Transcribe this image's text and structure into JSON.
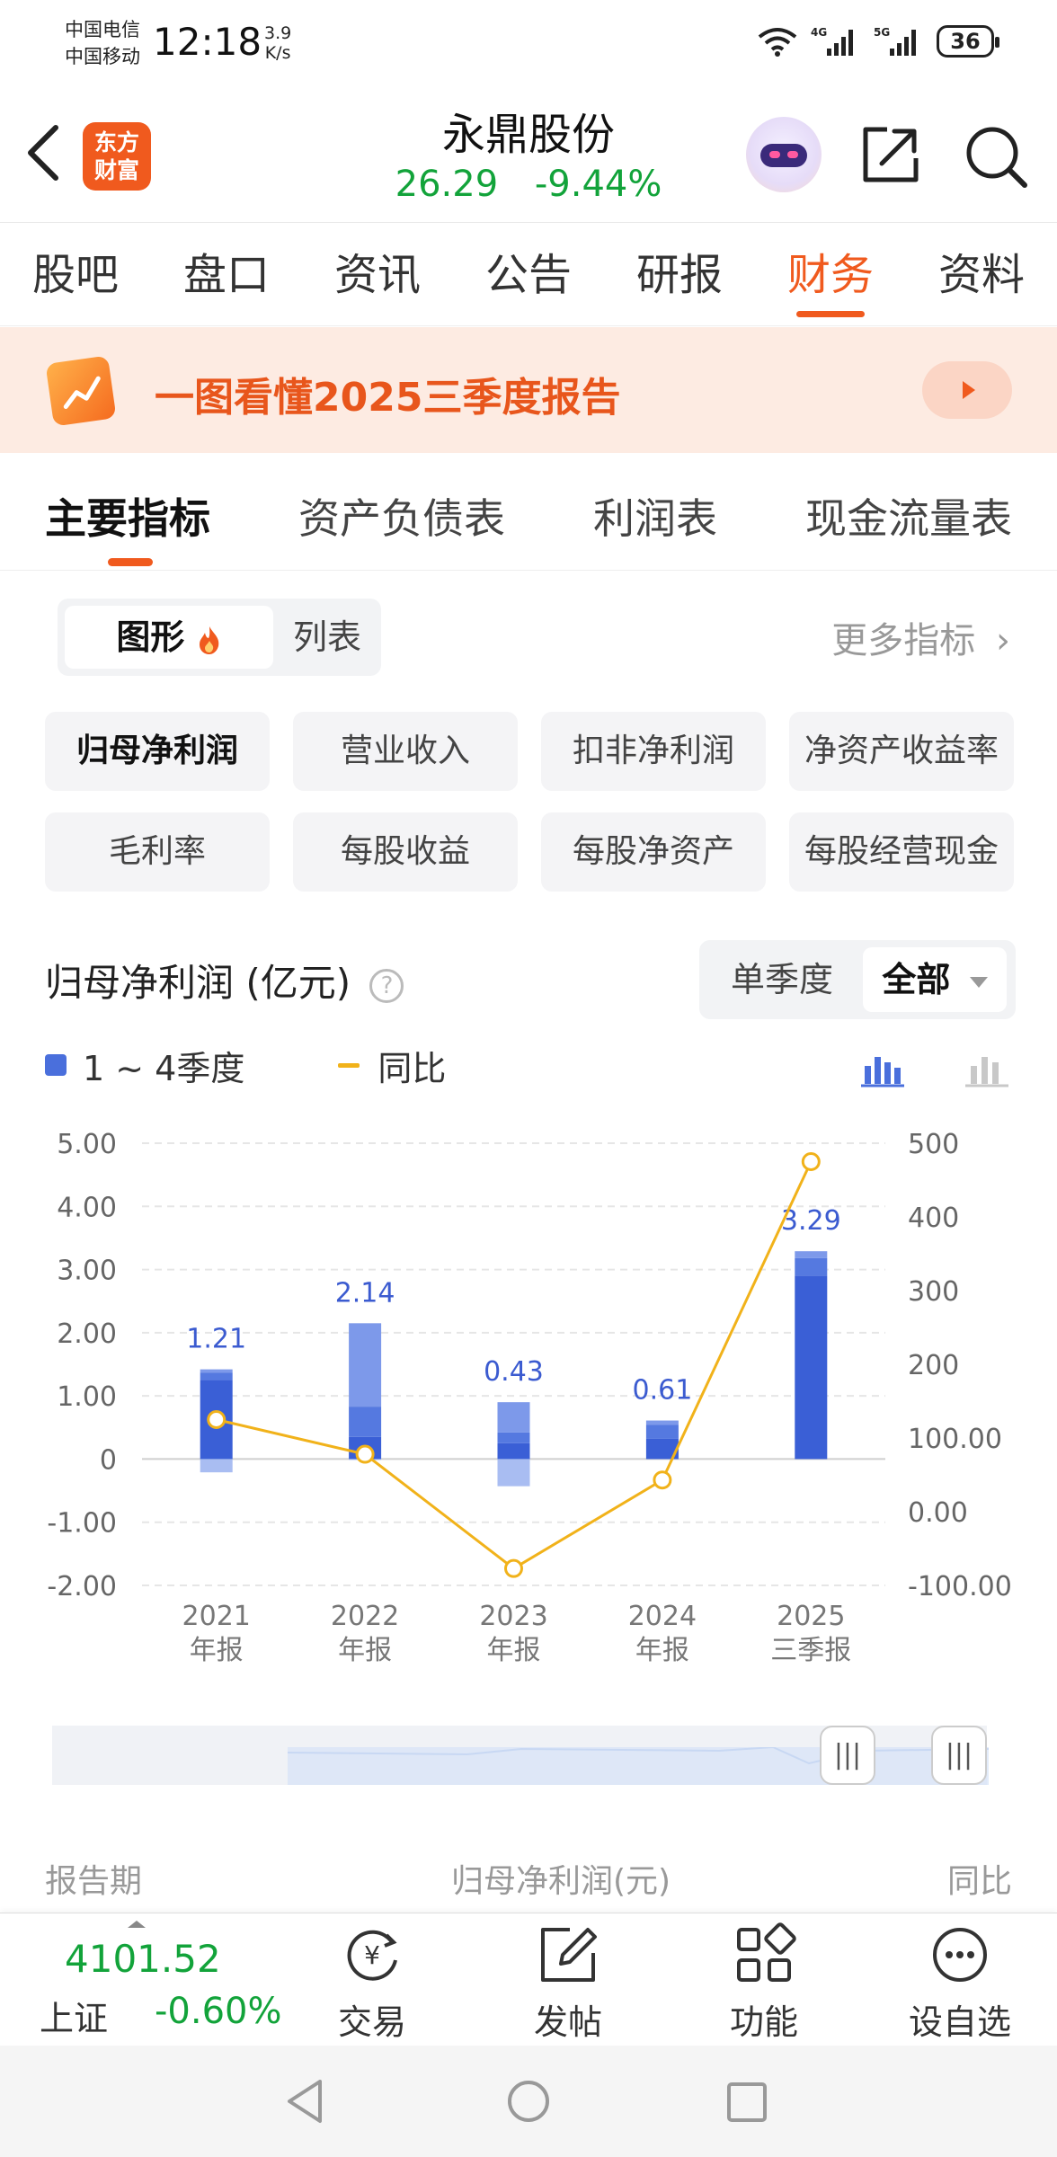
{
  "status_bar": {
    "carrier_1": "中国电信",
    "carrier_2": "中国移动",
    "time": "12:18",
    "net_speed_value": "3.9",
    "net_speed_unit": "K/s",
    "signal_1": "4G",
    "signal_2": "5G",
    "battery": "36"
  },
  "header": {
    "logo_line1": "东方",
    "logo_line2": "财富",
    "stock_name": "永鼎股份",
    "price": "26.29",
    "change_pct": "-9.44%"
  },
  "main_tabs": [
    "股吧",
    "盘口",
    "资讯",
    "公告",
    "研报",
    "财务",
    "资料"
  ],
  "active_main_tab": "财务",
  "banner": {
    "text": "一图看懂2025三季度报告"
  },
  "sub_tabs": [
    "主要指标",
    "资产负债表",
    "利润表",
    "现金流量表"
  ],
  "view_toggle": {
    "chart": "图形",
    "list": "列表"
  },
  "more_metrics": "更多指标",
  "metric_chips": [
    "归母净利润",
    "营业收入",
    "扣非净利润",
    "净资产收益率",
    "毛利率",
    "每股收益",
    "每股净资产",
    "每股经营现金"
  ],
  "chart_header": {
    "title": "归母净利润 (亿元)",
    "help": "?",
    "period_single": "单季度",
    "period_all": "全部"
  },
  "legend": {
    "bars": "1 ~ 4季度",
    "line": "同比"
  },
  "colors": {
    "accent": "#f05a1e",
    "down": "#12a33a",
    "bar": "#4a6fdc",
    "line": "#f1b21a"
  },
  "chart_data": {
    "type": "bar",
    "categories": [
      "2021\n年报",
      "2022\n年报",
      "2023\n年报",
      "2024\n年报",
      "2025\n三季报"
    ],
    "category_year": [
      "2021",
      "2022",
      "2023",
      "2024",
      "2025"
    ],
    "category_type": [
      "年报",
      "年报",
      "年报",
      "年报",
      "三季报"
    ],
    "totals": [
      1.21,
      2.14,
      0.43,
      0.61,
      3.29
    ],
    "quarters": [
      [
        1.25,
        0.12,
        0.05,
        -0.21
      ],
      [
        0.35,
        0.48,
        1.32,
        -0.01
      ],
      [
        0.25,
        0.17,
        0.48,
        -0.43
      ],
      [
        0.32,
        0.22,
        0.07,
        0.0
      ],
      [
        2.9,
        0.28,
        0.11,
        0.0
      ]
    ],
    "yoy": [
      125,
      78,
      -77,
      43,
      475
    ],
    "y_left": {
      "ticks": [
        "5.00",
        "4.00",
        "3.00",
        "2.00",
        "1.00",
        "0",
        "-1.00",
        "-2.00"
      ],
      "range": [
        -2,
        5
      ]
    },
    "y_right": {
      "ticks": [
        "500",
        "400",
        "300",
        "200",
        "100.00",
        "0.00",
        "-100.00"
      ],
      "range": [
        -100,
        500
      ]
    },
    "grid": true
  },
  "slider": {
    "handle": "|||"
  },
  "table_header": {
    "period": "报告期",
    "profit": "归母净利润(元)",
    "yoy": "同比"
  },
  "bottom_bar": {
    "index_value": "4101.52",
    "index_name": "上证",
    "index_change": "-0.60%",
    "trade": "交易",
    "post": "发帖",
    "functions": "功能",
    "watchlist": "设自选"
  }
}
